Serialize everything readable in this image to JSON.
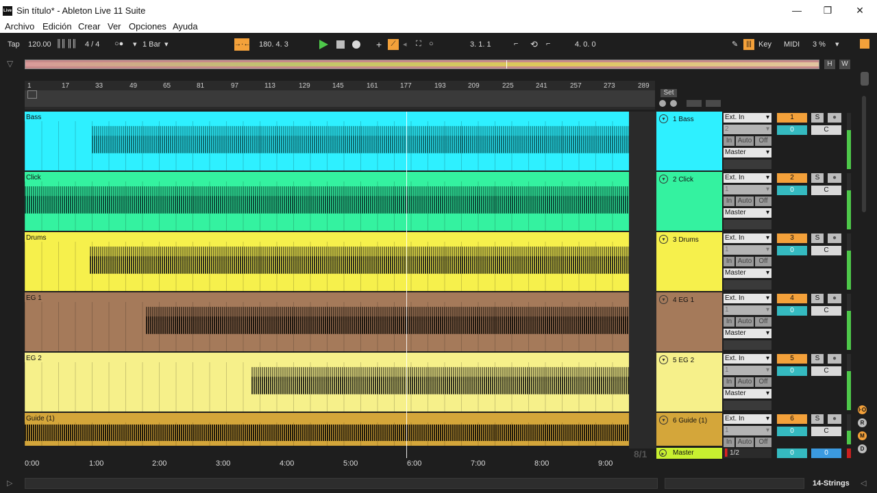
{
  "window": {
    "title": "Sin título* - Ableton Live 11 Suite",
    "app_icon": "Live",
    "minimize": "—",
    "maximize": "❐",
    "close": "✕"
  },
  "menu": [
    "Archivo",
    "Edición",
    "Crear",
    "Ver",
    "Opciones",
    "Ayuda"
  ],
  "control_bar": {
    "tap": "Tap",
    "tempo": "120.00",
    "signature": "4 / 4",
    "quantize": "1 Bar",
    "position": "180.   4.   3",
    "loop_start": "3.   1.   1",
    "loop_length": "4.   0.   0",
    "key": "Key",
    "midi": "MIDI",
    "cpu": "3 %"
  },
  "overview_buttons": [
    "H",
    "W"
  ],
  "ruler_marks": [
    "1",
    "17",
    "33",
    "49",
    "65",
    "81",
    "97",
    "113",
    "129",
    "145",
    "161",
    "177",
    "193",
    "209",
    "225",
    "241",
    "257",
    "273",
    "289"
  ],
  "time_marks": [
    "0:00",
    "1:00",
    "2:00",
    "3:00",
    "4:00",
    "5:00",
    "6:00",
    "7:00",
    "8:00",
    "9:00"
  ],
  "set_label": "Set",
  "tracks": [
    {
      "label": "Bass",
      "name": "1 Bass",
      "input": "Ext. In",
      "channel": "2",
      "out": "Master",
      "num": "1",
      "vol": "0",
      "pan": "C",
      "color": "#2ef0ff"
    },
    {
      "label": "Click",
      "name": "2 Click",
      "input": "Ext. In",
      "channel": "1",
      "out": "Master",
      "num": "2",
      "vol": "0",
      "pan": "C",
      "color": "#34f2a0"
    },
    {
      "label": "Drums",
      "name": "3 Drums",
      "input": "Ext. In",
      "channel": "1",
      "out": "Master",
      "num": "3",
      "vol": "0",
      "pan": "C",
      "color": "#f6f04c"
    },
    {
      "label": "EG 1",
      "name": "4 EG 1",
      "input": "Ext. In",
      "channel": "1",
      "out": "Master",
      "num": "4",
      "vol": "0",
      "pan": "C",
      "color": "#a57a5a"
    },
    {
      "label": "EG 2",
      "name": "5 EG 2",
      "input": "Ext. In",
      "channel": "1",
      "out": "Master",
      "num": "5",
      "vol": "0",
      "pan": "C",
      "color": "#f6f08a"
    },
    {
      "label": "Guide (1)",
      "name": "6 Guide (1)",
      "input": "Ext. In",
      "channel": "1",
      "out": "",
      "num": "6",
      "vol": "0",
      "pan": "C",
      "color": "#d4a63a"
    }
  ],
  "master": {
    "name": "Master",
    "output": "1/2",
    "vol": "0",
    "cue": "0"
  },
  "zoom_label": "8/1",
  "io_buttons": {
    "in": "In",
    "auto": "Auto",
    "off": "Off"
  },
  "solo": "S",
  "arm": "●",
  "side_buttons": [
    "I·O",
    "R",
    "M",
    "D"
  ],
  "status_right": "14-Strings"
}
